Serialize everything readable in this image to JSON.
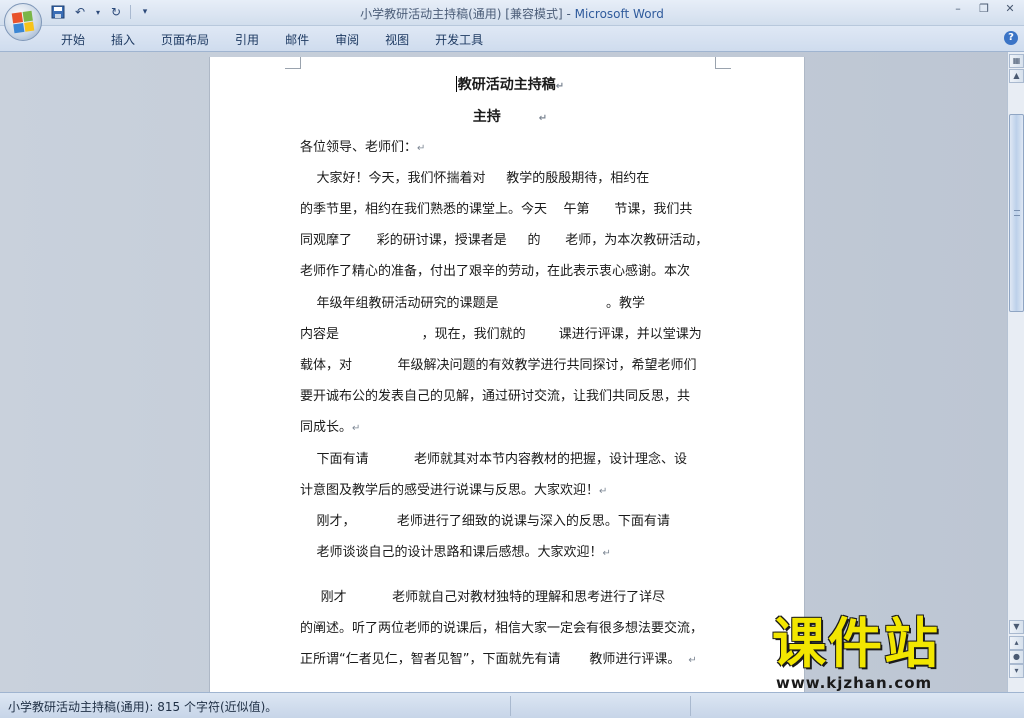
{
  "window": {
    "title": "小学教研活动主持稿(通用) [兼容模式] - ",
    "app_name": "Microsoft Word",
    "controls": [
      "–",
      "❐",
      "✕"
    ]
  },
  "quick_access": {
    "icons": [
      "save-icon",
      "undo-icon",
      "redo-icon",
      "customize-icon"
    ],
    "undo_glyph": "↶",
    "redo_glyph": "↻",
    "more_glyph": "▾"
  },
  "ribbon": {
    "tabs": [
      "开始",
      "插入",
      "页面布局",
      "引用",
      "邮件",
      "审阅",
      "视图",
      "开发工具"
    ],
    "help": "?"
  },
  "document": {
    "title": "教研活动主持稿",
    "subtitle": "主持",
    "lines": [
      "各位领导、老师们：",
      "    大家好！今天，我们怀揣着对     教学的殷殷期待，相约在",
      "的季节里，相约在我们熟悉的课堂上。今天    午第      节课，我们共",
      "同观摩了      彩的研讨课，授课者是     的      老师，为本次教研活动，",
      "老师作了精心的准备，付出了艰辛的劳动，在此表示衷心感谢。本次",
      "    年级年组教研活动研究的课题是                          。教学",
      "内容是                    ，现在，我们就的        课进行评课，并以堂课为",
      "载体，对           年级解决问题的有效教学进行共同探讨，希望老师们",
      "要开诚布公的发表自己的见解，通过研讨交流，让我们共同反思，共",
      "同成长。",
      "    下面有请           老师就其对本节内容教材的把握，设计理念、设",
      "计意图及教学后的感受进行说课与反思。大家欢迎！",
      "    刚才，          老师进行了细致的说课与深入的反思。下面有请",
      "    老师谈谈自己的设计思路和课后感想。大家欢迎！",
      "     刚才           老师就自己对教材独特的理解和思考进行了详尽",
      "的阐述。听了两位老师的说课后，相信大家一定会有很多想法要交流，",
      "正所谓“仁者见仁，智者见智”，下面就先有请       教师进行评课。"
    ],
    "paragraph_mark": "↵"
  },
  "status": {
    "text": "小学教研活动主持稿(通用): 815 个字符(近似值)。"
  },
  "watermark": {
    "big": "课件站",
    "url": "www.kjzhan.com"
  }
}
